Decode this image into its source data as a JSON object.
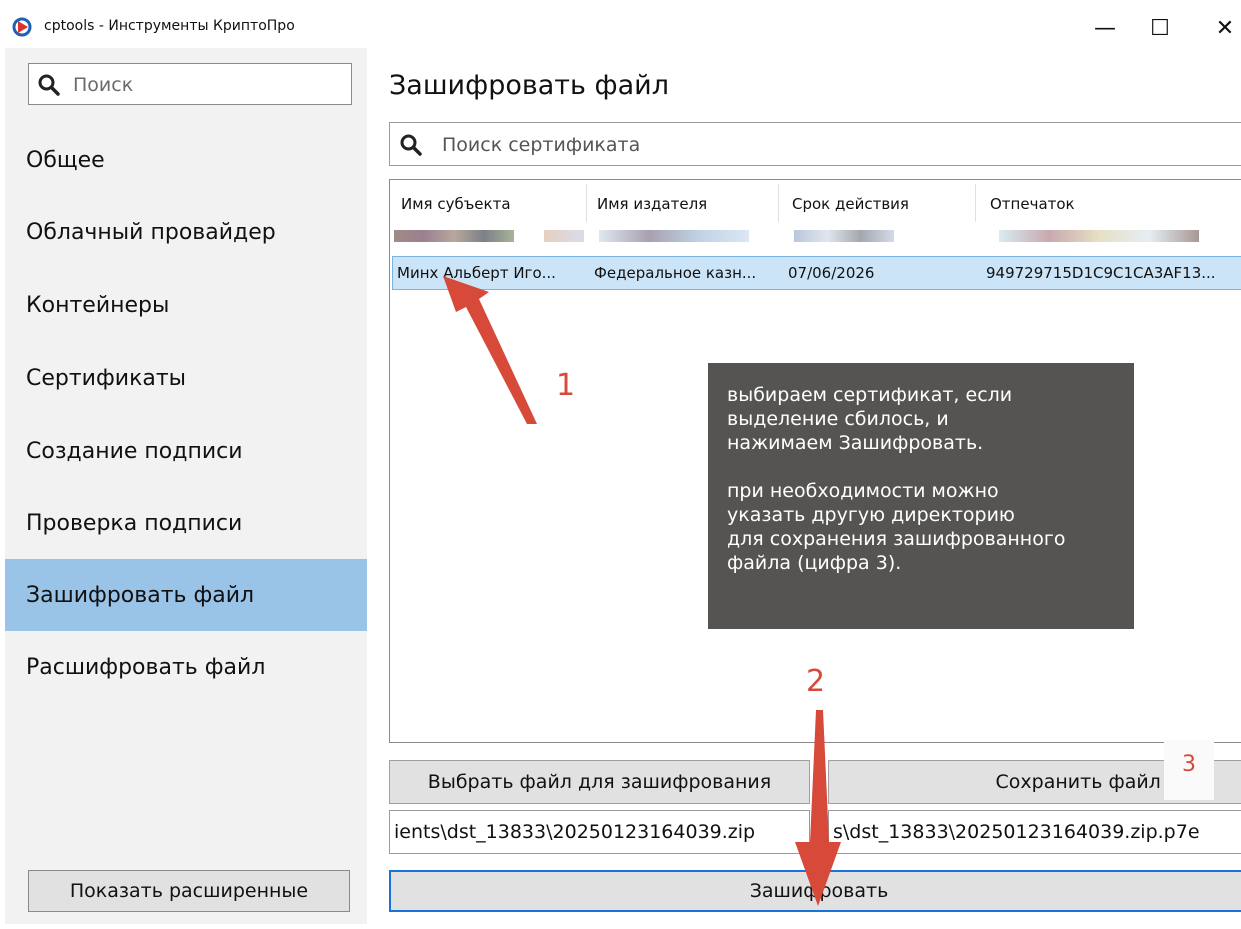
{
  "window": {
    "title": "cptools - Инструменты КриптоПро",
    "minimize_glyph": "—",
    "maximize_glyph": "☐",
    "close_glyph": "✕"
  },
  "sidebar": {
    "search_placeholder": "Поиск",
    "items": [
      {
        "label": "Общее"
      },
      {
        "label": "Облачный провайдер"
      },
      {
        "label": "Контейнеры"
      },
      {
        "label": "Сертификаты"
      },
      {
        "label": "Создание подписи"
      },
      {
        "label": "Проверка подписи"
      },
      {
        "label": "Зашифровать файл",
        "active": true
      },
      {
        "label": "Расшифровать файл"
      }
    ],
    "show_advanced_label": "Показать расширенные"
  },
  "main": {
    "title": "Зашифровать файл",
    "cert_search_placeholder": "Поиск сертификата",
    "table": {
      "columns": [
        "Имя субъекта",
        "Имя издателя",
        "Срок действия",
        "Отпечаток"
      ],
      "selected_row": {
        "subject": "Минх Альберт Иго...",
        "issuer": "Федеральное казн...",
        "expiry": "07/06/2026",
        "thumbprint": "949729715D1C9C1CA3AF13..."
      }
    },
    "choose_file_label": "Выбрать файл для зашифрования",
    "save_as_label": "Сохранить файл как",
    "input_path": "ients\\dst_13833\\20250123164039.zip",
    "output_path": "s\\dst_13833\\20250123164039.zip.p7e",
    "encrypt_label": "Зашифровать"
  },
  "annotation": {
    "note": "выбираем сертификат, если\nвыделение сбилось, и\nнажимаем Зашифровать.\n\nпри необходимости можно\nуказать другую директорию\nдля сохранения зашифрованного\nфайла (цифра 3).",
    "step1": "1",
    "step2": "2",
    "step3": "3",
    "color": "#d74a3a"
  }
}
